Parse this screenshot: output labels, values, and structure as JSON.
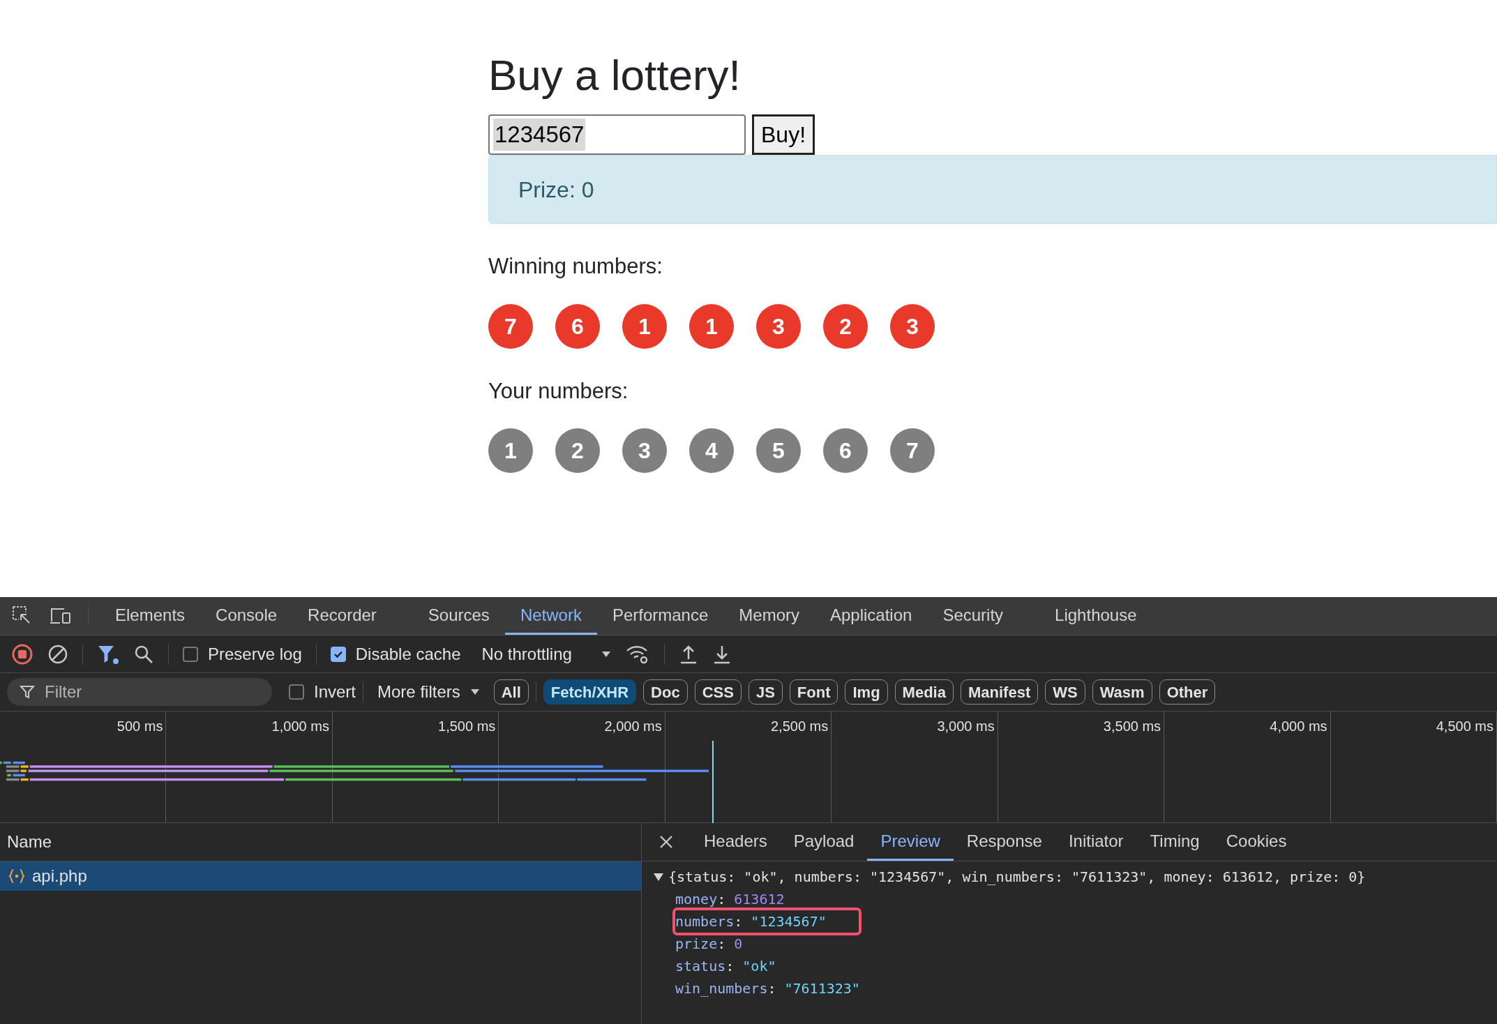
{
  "page": {
    "title": "Buy a lottery!",
    "input": {
      "value": "1234567",
      "selected_text": true
    },
    "buy_button": "Buy!",
    "alert": "Prize: 0",
    "sections": [
      {
        "kind": "winning",
        "label": "Winning numbers:",
        "balls": [
          "7",
          "6",
          "1",
          "1",
          "3",
          "2",
          "3"
        ]
      },
      {
        "kind": "yours",
        "label": "Your numbers:",
        "balls": [
          "1",
          "2",
          "3",
          "4",
          "5",
          "6",
          "7"
        ]
      }
    ]
  },
  "devtools": {
    "tabs": [
      {
        "label": "Elements",
        "selected": false
      },
      {
        "label": "Console",
        "selected": false
      },
      {
        "label": "Recorder",
        "selected": false
      },
      {
        "label": "Sources",
        "selected": false
      },
      {
        "label": "Network",
        "selected": true
      },
      {
        "label": "Performance",
        "selected": false
      },
      {
        "label": "Memory",
        "selected": false
      },
      {
        "label": "Application",
        "selected": false
      },
      {
        "label": "Security",
        "selected": false
      },
      {
        "label": "Lighthouse",
        "selected": false
      }
    ],
    "toolbar": {
      "recording": true,
      "preserve_log": {
        "label": "Preserve log",
        "checked": false
      },
      "disable_cache": {
        "label": "Disable cache",
        "checked": true
      },
      "throttling": "No throttling"
    },
    "filter": {
      "placeholder": "Filter",
      "invert": {
        "label": "Invert",
        "checked": false
      },
      "more_filters": "More filters",
      "types": [
        {
          "label": "All",
          "selected": false
        },
        {
          "label": "Fetch/XHR",
          "selected": true
        },
        {
          "label": "Doc",
          "selected": false
        },
        {
          "label": "CSS",
          "selected": false
        },
        {
          "label": "JS",
          "selected": false
        },
        {
          "label": "Font",
          "selected": false
        },
        {
          "label": "Img",
          "selected": false
        },
        {
          "label": "Media",
          "selected": false
        },
        {
          "label": "Manifest",
          "selected": false
        },
        {
          "label": "WS",
          "selected": false
        },
        {
          "label": "Wasm",
          "selected": false
        },
        {
          "label": "Other",
          "selected": false
        }
      ]
    },
    "timeline": {
      "ticks": [
        "500 ms",
        "1,000 ms",
        "1,500 ms",
        "2,000 ms",
        "2,500 ms",
        "3,000 ms",
        "3,500 ms",
        "4,000 ms",
        "4,500 ms"
      ]
    },
    "requests": {
      "column": "Name",
      "rows": [
        {
          "name": "api.php",
          "selected": true
        }
      ]
    },
    "detail_tabs": [
      {
        "label": "Headers",
        "selected": false
      },
      {
        "label": "Payload",
        "selected": false
      },
      {
        "label": "Preview",
        "selected": true
      },
      {
        "label": "Response",
        "selected": false
      },
      {
        "label": "Initiator",
        "selected": false
      },
      {
        "label": "Timing",
        "selected": false
      },
      {
        "label": "Cookies",
        "selected": false
      }
    ],
    "preview": {
      "expanded": true,
      "key_separator": ":",
      "summary": "{status: \"ok\", numbers: \"1234567\", win_numbers: \"7611323\", money: 613612, prize: 0}",
      "properties": [
        {
          "key": "money",
          "value": "613612",
          "kind": "number",
          "highlighted": false
        },
        {
          "key": "numbers",
          "value": "\"1234567\"",
          "kind": "string",
          "highlighted": true
        },
        {
          "key": "prize",
          "value": "0",
          "kind": "number",
          "highlighted": false
        },
        {
          "key": "status",
          "value": "\"ok\"",
          "kind": "string",
          "highlighted": false
        },
        {
          "key": "win_numbers",
          "value": "\"7611323\"",
          "kind": "string",
          "highlighted": false
        }
      ]
    }
  }
}
